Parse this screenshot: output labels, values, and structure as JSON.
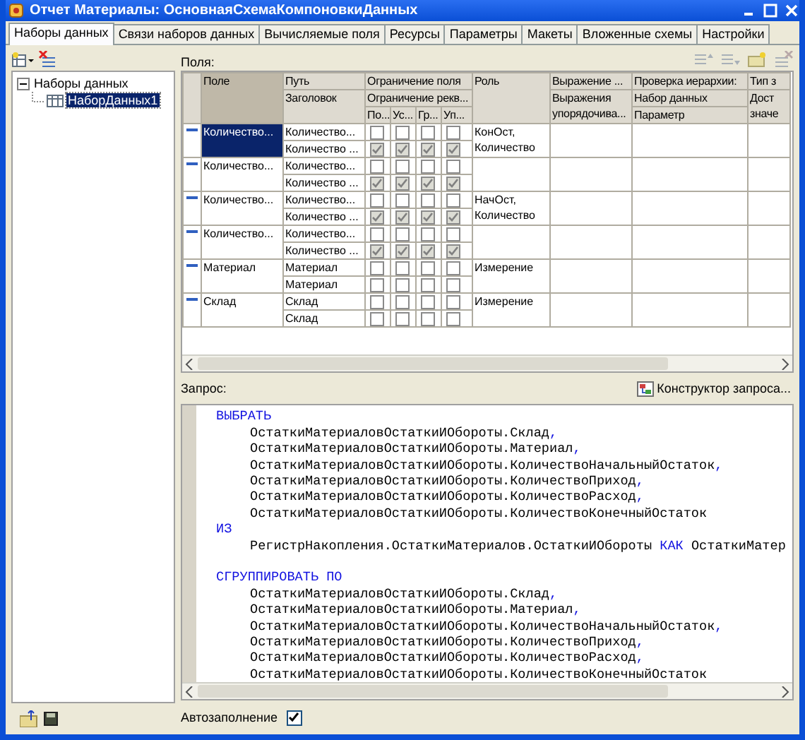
{
  "window": {
    "title": "Отчет Материалы: ОсновнаяСхемаКомпоновкиДанных"
  },
  "tabs": [
    {
      "label": "Наборы данных",
      "selected": true
    },
    {
      "label": "Связи наборов данных",
      "selected": false
    },
    {
      "label": "Вычисляемые поля",
      "selected": false
    },
    {
      "label": "Ресурсы",
      "selected": false
    },
    {
      "label": "Параметры",
      "selected": false
    },
    {
      "label": "Макеты",
      "selected": false
    },
    {
      "label": "Вложенные схемы",
      "selected": false
    },
    {
      "label": "Настройки",
      "selected": false
    }
  ],
  "tree": [
    {
      "label": "Наборы данных",
      "expanded": true,
      "selected": false,
      "children": [
        {
          "label": "НаборДанных1",
          "selected": true
        }
      ]
    }
  ],
  "fields": {
    "label": "Поля:",
    "header": {
      "field": {
        "text": "Поле",
        "sorted": true
      },
      "path": "Путь",
      "title": "Заголовок",
      "field_restriction": "Ограничение поля",
      "attribute_restriction": "Ограничение рекв...",
      "restriction_columns": [
        "По...",
        "Ус...",
        "Гр...",
        "Уп..."
      ],
      "role": "Роль",
      "expression": "Выражение ...",
      "order_expression": "Выражения упорядочива...",
      "hierarchy_check": "Проверка иерархии:",
      "hierarchy_dataset": "Набор данных",
      "hierarchy_parameter": "Параметр",
      "column_9": {
        "line_1": "Тип з",
        "line_2": "Дост значе"
      }
    },
    "rows": [
      {
        "name": "Количество...",
        "selected": true,
        "path": "Количество...",
        "title": "Количество ...",
        "field_restrictions": [
          false,
          false,
          false,
          false
        ],
        "attribute_restrictions": [
          true,
          true,
          true,
          true
        ],
        "role": "КонОст, Количество"
      },
      {
        "name": "Количество...",
        "selected": false,
        "path": "Количество...",
        "title": "Количество ...",
        "field_restrictions": [
          false,
          false,
          false,
          false
        ],
        "attribute_restrictions": [
          true,
          true,
          true,
          true
        ]
      },
      {
        "name": "Количество...",
        "selected": false,
        "path": "Количество...",
        "title": "Количество ...",
        "field_restrictions": [
          false,
          false,
          false,
          false
        ],
        "attribute_restrictions": [
          true,
          true,
          true,
          true
        ],
        "role": "НачОст, Количество"
      },
      {
        "name": "Количество...",
        "selected": false,
        "path": "Количество...",
        "title": "Количество ...",
        "field_restrictions": [
          false,
          false,
          false,
          false
        ],
        "attribute_restrictions": [
          true,
          true,
          true,
          true
        ]
      },
      {
        "name": "Материал",
        "selected": false,
        "path": "Материал",
        "title": "Материал",
        "field_restrictions": [
          false,
          false,
          false,
          false
        ],
        "attribute_restrictions": [
          false,
          false,
          false,
          false
        ],
        "role": "Измерение"
      },
      {
        "name": "Склад",
        "selected": false,
        "path": "Склад",
        "title": "Склад",
        "field_restrictions": [
          false,
          false,
          false,
          false
        ],
        "attribute_restrictions": [
          false,
          false,
          false,
          false
        ],
        "role": "Измерение"
      }
    ]
  },
  "query": {
    "label": "Запрос:",
    "designer_button": "Конструктор запроса...",
    "lines": [
      {
        "kind": "keyword",
        "segments": [
          {
            "text": "ВЫБРАТЬ",
            "kind": "keyword"
          }
        ]
      },
      {
        "kind": "item",
        "segments": [
          {
            "text": "ОстаткиМатериаловОстаткиИОбороты.Склад",
            "kind": "name"
          },
          {
            "text": ",",
            "kind": "punct"
          }
        ]
      },
      {
        "kind": "item",
        "segments": [
          {
            "text": "ОстаткиМатериаловОстаткиИОбороты.Материал",
            "kind": "name"
          },
          {
            "text": ",",
            "kind": "punct"
          }
        ]
      },
      {
        "kind": "item",
        "segments": [
          {
            "text": "ОстаткиМатериаловОстаткиИОбороты.КоличествоНачальныйОстаток",
            "kind": "name"
          },
          {
            "text": ",",
            "kind": "punct"
          }
        ]
      },
      {
        "kind": "item",
        "segments": [
          {
            "text": "ОстаткиМатериаловОстаткиИОбороты.КоличествоПриход",
            "kind": "name"
          },
          {
            "text": ",",
            "kind": "punct"
          }
        ]
      },
      {
        "kind": "item",
        "segments": [
          {
            "text": "ОстаткиМатериаловОстаткиИОбороты.КоличествоРасход",
            "kind": "name"
          },
          {
            "text": ",",
            "kind": "punct"
          }
        ]
      },
      {
        "kind": "item",
        "segments": [
          {
            "text": "ОстаткиМатериаловОстаткиИОбороты.КоличествоКонечныйОстаток",
            "kind": "name"
          }
        ]
      },
      {
        "kind": "keyword",
        "segments": [
          {
            "text": "ИЗ",
            "kind": "keyword"
          }
        ]
      },
      {
        "kind": "item",
        "segments": [
          {
            "text": "РегистрНакопления.ОстаткиМатериалов.ОстаткиИОбороты ",
            "kind": "name"
          },
          {
            "text": "КАК",
            "kind": "keyword"
          },
          {
            "text": " ОстаткиМатер",
            "kind": "name"
          }
        ]
      },
      {
        "kind": "blank"
      },
      {
        "kind": "keyword",
        "segments": [
          {
            "text": "СГРУППИРОВАТЬ ПО",
            "kind": "keyword"
          }
        ]
      },
      {
        "kind": "item",
        "segments": [
          {
            "text": "ОстаткиМатериаловОстаткиИОбороты.Склад",
            "kind": "name"
          },
          {
            "text": ",",
            "kind": "punct"
          }
        ]
      },
      {
        "kind": "item",
        "segments": [
          {
            "text": "ОстаткиМатериаловОстаткиИОбороты.Материал",
            "kind": "name"
          },
          {
            "text": ",",
            "kind": "punct"
          }
        ]
      },
      {
        "kind": "item",
        "segments": [
          {
            "text": "ОстаткиМатериаловОстаткиИОбороты.КоличествоНачальныйОстаток",
            "kind": "name"
          },
          {
            "text": ",",
            "kind": "punct"
          }
        ]
      },
      {
        "kind": "item",
        "segments": [
          {
            "text": "ОстаткиМатериаловОстаткиИОбороты.КоличествоПриход",
            "kind": "name"
          },
          {
            "text": ",",
            "kind": "punct"
          }
        ]
      },
      {
        "kind": "item",
        "segments": [
          {
            "text": "ОстаткиМатериаловОстаткиИОбороты.КоличествоРасход",
            "kind": "name"
          },
          {
            "text": ",",
            "kind": "punct"
          }
        ]
      },
      {
        "kind": "item",
        "segments": [
          {
            "text": "ОстаткиМатериаловОстаткиИОбороты.КоличествоКонечныйОстаток",
            "kind": "name"
          }
        ]
      }
    ]
  },
  "autofill": {
    "label": "Автозаполнение",
    "checked": true
  }
}
